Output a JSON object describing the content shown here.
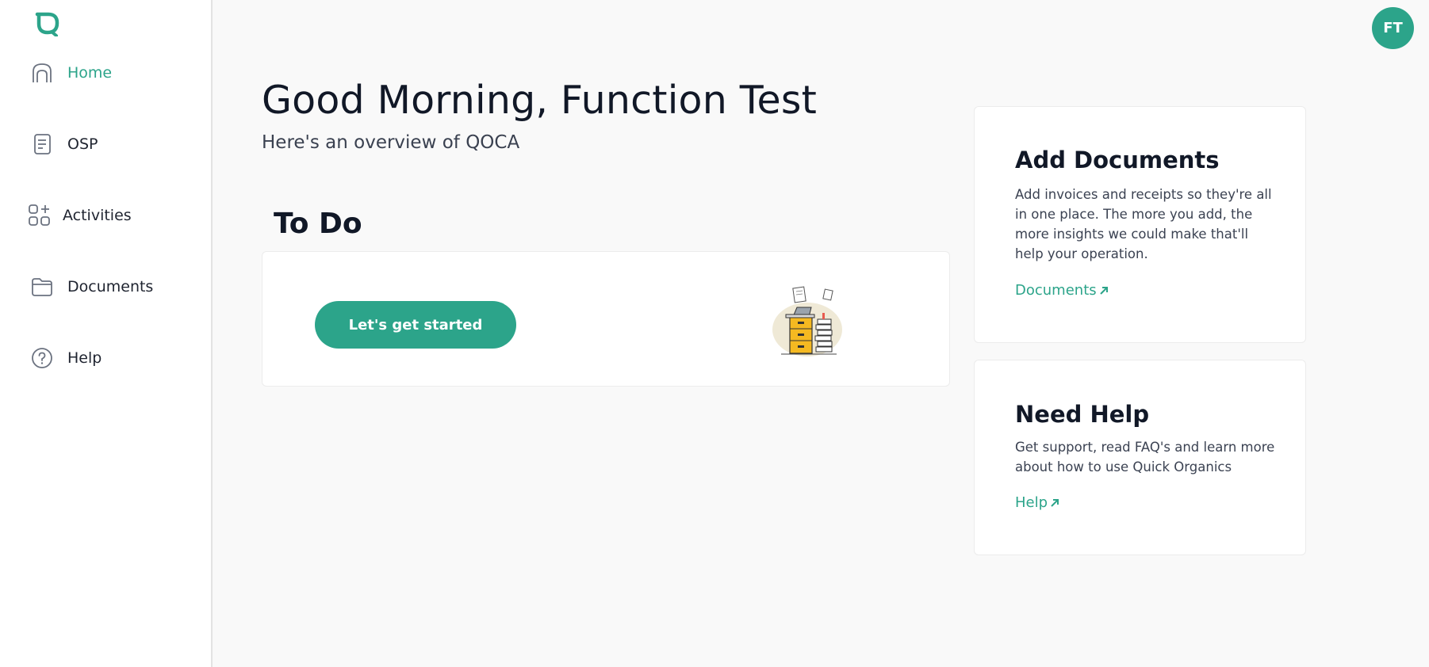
{
  "sidebar": {
    "logo_icon": "leaf-logo",
    "items": [
      {
        "label": "Home",
        "icon": "home-icon",
        "active": true
      },
      {
        "label": "OSP",
        "icon": "document-list-icon",
        "active": false
      },
      {
        "label": "Activities",
        "icon": "grid-plus-icon",
        "active": false
      },
      {
        "label": "Documents",
        "icon": "folder-icon",
        "active": false
      },
      {
        "label": "Help",
        "icon": "help-circle-icon",
        "active": false
      }
    ]
  },
  "header": {
    "avatar_initials": "FT"
  },
  "main": {
    "greeting": "Good Morning, Function Test",
    "subtitle": "Here's an overview of QOCA",
    "todo": {
      "title": "To Do",
      "button_label": "Let's get started"
    }
  },
  "cards": {
    "add_documents": {
      "title": "Add Documents",
      "text": "Add invoices and receipts so they're all in one place. The more you add, the more insights we could make that'll help your operation.",
      "link": "Documents"
    },
    "need_help": {
      "title": "Need Help",
      "text": "Get support, read FAQ's and learn more about how to use Quick Organics",
      "link": "Help"
    }
  },
  "colors": {
    "accent": "#2ca48a",
    "background": "#f9f9f9",
    "text": "#111827"
  }
}
